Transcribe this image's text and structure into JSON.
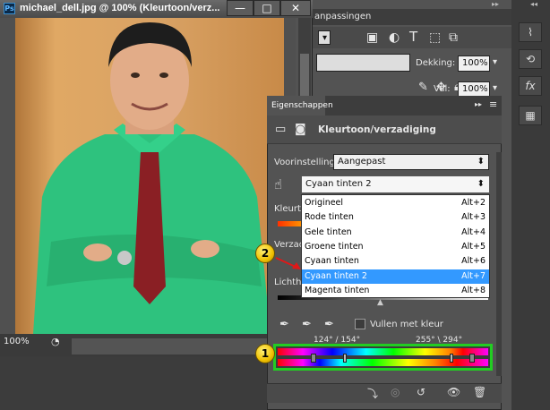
{
  "document": {
    "logo": "Ps",
    "title": "michael_dell.jpg @ 100% (Kleurtoon/verz...",
    "zoom": "100%",
    "buttons": {
      "minimize": "—",
      "maximize": "□",
      "close": "✕"
    }
  },
  "layers_panel": {
    "tab": "anpassingen",
    "opacity_label": "Dekking:",
    "opacity_value": "100%",
    "fill_label": "Vul:",
    "fill_value": "100%"
  },
  "properties": {
    "tab": "Eigenschappen",
    "heading": "Kleurtoon/verzadiging",
    "preset_label": "Voorinstelling:",
    "preset_value": "Aangepast",
    "channel_value": "Cyaan tinten 2",
    "hue_label": "Kleurto",
    "saturation_label": "Verzadi",
    "lightness_label": "Lichthe",
    "colorize_label": "Vullen met kleur",
    "range_left": "124° / 154°",
    "range_right": "255° \\ 294°",
    "menu": [
      {
        "label": "Origineel",
        "shortcut": "Alt+2"
      },
      {
        "label": "Rode tinten",
        "shortcut": "Alt+3"
      },
      {
        "label": "Gele tinten",
        "shortcut": "Alt+4"
      },
      {
        "label": "Groene tinten",
        "shortcut": "Alt+5"
      },
      {
        "label": "Cyaan tinten",
        "shortcut": "Alt+6"
      },
      {
        "label": "Cyaan tinten 2",
        "shortcut": "Alt+7"
      },
      {
        "label": "Magenta tinten",
        "shortcut": "Alt+8"
      }
    ],
    "selected_index": 5
  },
  "annotations": {
    "badge1": "1",
    "badge2": "2"
  },
  "colors": {
    "highlight": "#3399ff",
    "annotation_box": "#22cc22",
    "shirt": "#2ec27e",
    "tie": "#8a1f24"
  }
}
